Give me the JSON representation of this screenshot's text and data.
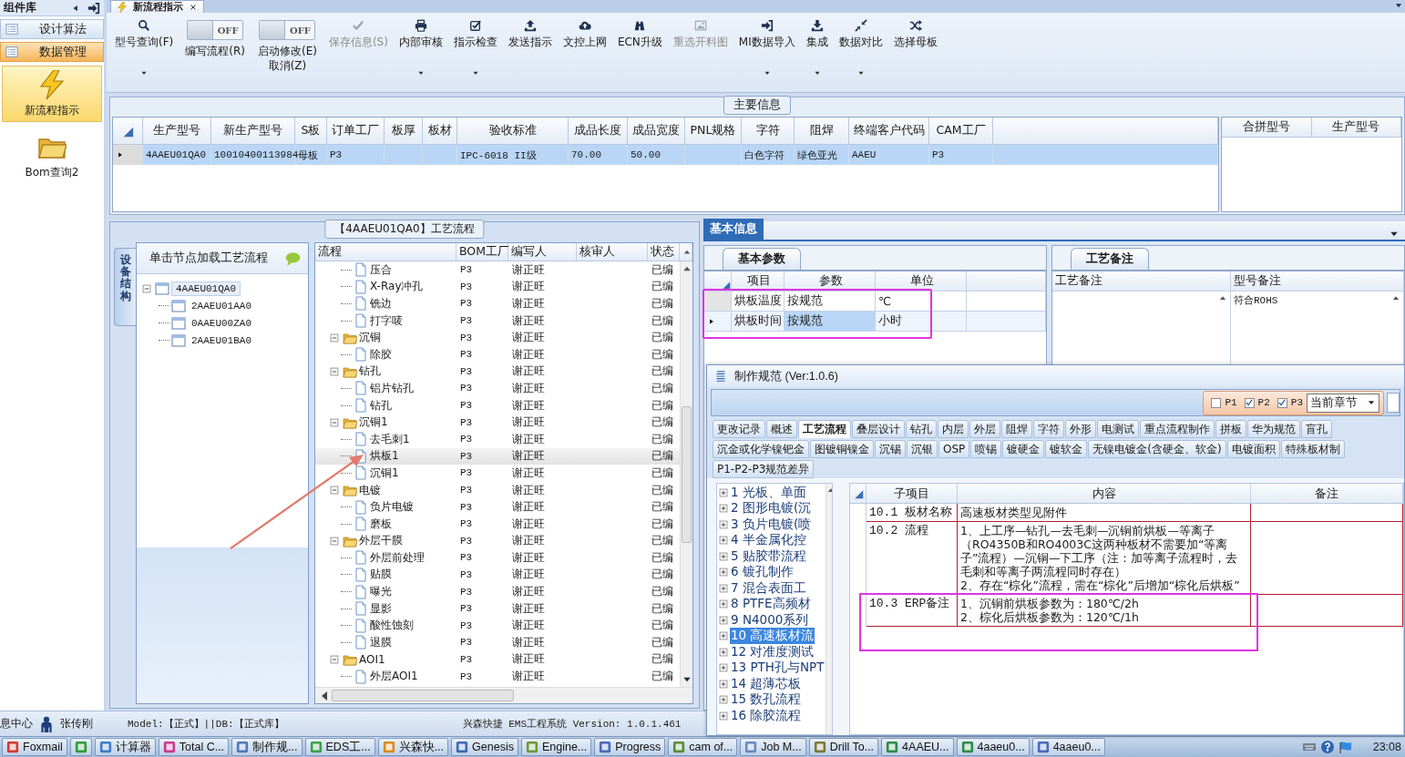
{
  "sidebar": {
    "title": "组件库",
    "groups": [
      {
        "label": "设计算法",
        "selected": false
      },
      {
        "label": "数据管理",
        "selected": true
      }
    ],
    "items": [
      {
        "label": "新流程指示",
        "selected": true
      },
      {
        "label": "Bom查询2",
        "selected": false
      }
    ]
  },
  "doc_tabs": [
    {
      "label": "新流程指示",
      "selected": true
    }
  ],
  "ribbon": [
    {
      "kind": "button",
      "label": "型号查询(F)",
      "dropdown": true,
      "disabled": false
    },
    {
      "kind": "toggle",
      "toggle_text": "OFF",
      "on": false,
      "label": "编写流程(R)"
    },
    {
      "kind": "toggle",
      "toggle_text": "OFF",
      "on": false,
      "label": "启动修改(E)\n取消(Z)"
    },
    {
      "kind": "button",
      "label": "保存信息(S)",
      "dropdown": false,
      "disabled": true
    },
    {
      "kind": "button",
      "label": "内部审核",
      "dropdown": true,
      "disabled": false
    },
    {
      "kind": "button",
      "label": "指示检查",
      "dropdown": true,
      "disabled": false
    },
    {
      "kind": "button",
      "label": "发送指示",
      "dropdown": false,
      "disabled": false
    },
    {
      "kind": "button",
      "label": "文控上网",
      "dropdown": false,
      "disabled": false
    },
    {
      "kind": "button",
      "label": "ECN升级",
      "dropdown": false,
      "disabled": false
    },
    {
      "kind": "button",
      "label": "重选开料图",
      "dropdown": false,
      "disabled": true
    },
    {
      "kind": "button",
      "label": "MI数据导入",
      "dropdown": true,
      "disabled": false
    },
    {
      "kind": "button",
      "label": "集成",
      "dropdown": true,
      "disabled": false
    },
    {
      "kind": "button",
      "label": "数据对比",
      "dropdown": true,
      "disabled": false
    },
    {
      "kind": "button",
      "label": "选择母板",
      "dropdown": false,
      "disabled": false
    }
  ],
  "main_info": {
    "title": "主要信息",
    "columns": [
      "生产型号",
      "新生产型号",
      "S板",
      "订单工厂",
      "板厚",
      "板材",
      "验收标准",
      "成品长度",
      "成品宽度",
      "PNL规格",
      "字符",
      "阻焊",
      "终端客户代码",
      "CAM工厂"
    ],
    "rows": [
      {
        "selected": true,
        "cells": [
          "4AAEU01QA0",
          "10010400113984",
          "母板",
          "P3",
          null,
          null,
          "IPC-6018 II级",
          "70.00",
          "50.00",
          null,
          "白色字符",
          "绿色亚光",
          "AAEU",
          "P3"
        ]
      }
    ],
    "merge_columns": [
      "合拼型号",
      "生产型号"
    ]
  },
  "process": {
    "title": "【4AAEU01QA0】工艺流程",
    "side_tab": "设备结构",
    "tree_header": "单击节点加载工艺流程",
    "tree": [
      {
        "label": "4AAEU01QA0",
        "expanded": true,
        "selected": true,
        "children": [
          {
            "label": "2AAEU01AA0",
            "selected": false
          },
          {
            "label": "0AAEU00ZA0",
            "selected": false
          },
          {
            "label": "2AAEU01BA0",
            "selected": false
          }
        ]
      }
    ],
    "columns": [
      "流程",
      "BOM工厂",
      "编写人",
      "核审人",
      "状态"
    ],
    "arrow_marker": true,
    "rows": [
      {
        "kind": "group",
        "children": [
          {
            "kind": "step",
            "label": "压合",
            "bom": "P3",
            "author": "谢正旺",
            "status": "已编",
            "selected": false
          },
          {
            "kind": "step",
            "label": "X-Ray冲孔",
            "bom": "P3",
            "author": "谢正旺",
            "status": "已编",
            "selected": false
          },
          {
            "kind": "step",
            "label": "铣边",
            "bom": "P3",
            "author": "谢正旺",
            "status": "已编",
            "selected": false
          },
          {
            "kind": "step",
            "label": "打字唛",
            "bom": "P3",
            "author": "谢正旺",
            "status": "已编",
            "selected": false
          }
        ]
      },
      {
        "kind": "folder",
        "label": "沉铜",
        "bom": "P3",
        "author": "谢正旺",
        "status": "已编",
        "selected": false,
        "expanded": true,
        "children": [
          {
            "kind": "step",
            "label": "除胶",
            "bom": "P3",
            "author": "谢正旺",
            "status": "已编",
            "selected": false
          }
        ]
      },
      {
        "kind": "folder",
        "label": "钻孔",
        "bom": "P3",
        "author": "谢正旺",
        "status": "已编",
        "selected": false,
        "expanded": true,
        "children": [
          {
            "kind": "step",
            "label": "铝片钻孔",
            "bom": "P3",
            "author": "谢正旺",
            "status": "已编",
            "selected": false
          },
          {
            "kind": "step",
            "label": "钻孔",
            "bom": "P3",
            "author": "谢正旺",
            "status": "已编",
            "selected": false
          }
        ]
      },
      {
        "kind": "folder",
        "label": "沉铜1",
        "bom": "P3",
        "author": "谢正旺",
        "status": "已编",
        "selected": false,
        "expanded": true,
        "children": [
          {
            "kind": "step",
            "label": "去毛刺1",
            "bom": "P3",
            "author": "谢正旺",
            "status": "已编",
            "selected": false
          },
          {
            "kind": "step",
            "label": "烘板1",
            "bom": "P3",
            "author": "谢正旺",
            "status": "已编",
            "selected": true
          },
          {
            "kind": "step",
            "label": "沉铜1",
            "bom": "P3",
            "author": "谢正旺",
            "status": "已编",
            "selected": false
          }
        ]
      },
      {
        "kind": "folder",
        "label": "电镀",
        "bom": "P3",
        "author": "谢正旺",
        "status": "已编",
        "selected": false,
        "expanded": true,
        "children": [
          {
            "kind": "step",
            "label": "负片电镀",
            "bom": "P3",
            "author": "谢正旺",
            "status": "已编",
            "selected": false
          },
          {
            "kind": "step",
            "label": "磨板",
            "bom": "P3",
            "author": "谢正旺",
            "status": "已编",
            "selected": false
          }
        ]
      },
      {
        "kind": "folder",
        "label": "外层干膜",
        "bom": "P3",
        "author": "谢正旺",
        "status": "已编",
        "selected": false,
        "expanded": true,
        "children": [
          {
            "kind": "step",
            "label": "外层前处理",
            "bom": "P3",
            "author": "谢正旺",
            "status": "已编",
            "selected": false
          },
          {
            "kind": "step",
            "label": "贴膜",
            "bom": "P3",
            "author": "谢正旺",
            "status": "已编",
            "selected": false
          },
          {
            "kind": "step",
            "label": "曝光",
            "bom": "P3",
            "author": "谢正旺",
            "status": "已编",
            "selected": false
          },
          {
            "kind": "step",
            "label": "显影",
            "bom": "P3",
            "author": "谢正旺",
            "status": "已编",
            "selected": false
          },
          {
            "kind": "step",
            "label": "酸性蚀刻",
            "bom": "P3",
            "author": "谢正旺",
            "status": "已编",
            "selected": false
          },
          {
            "kind": "step",
            "label": "退膜",
            "bom": "P3",
            "author": "谢正旺",
            "status": "已编",
            "selected": false
          }
        ]
      },
      {
        "kind": "folder",
        "label": "AOI1",
        "bom": "P3",
        "author": "谢正旺",
        "status": "已编",
        "selected": false,
        "expanded": true,
        "children": [
          {
            "kind": "step",
            "label": "外层AOI1",
            "bom": "P3",
            "author": "谢正旺",
            "status": "已编",
            "selected": false
          }
        ]
      }
    ]
  },
  "info": {
    "tabs": [
      {
        "label": "基本信息",
        "selected": true
      }
    ],
    "params": {
      "tab": "基本参数",
      "columns": [
        "项目",
        "参数",
        "单位"
      ],
      "highlight_box": true,
      "rows": [
        {
          "selected": false,
          "cells": [
            "烘板温度",
            "按规范",
            "℃"
          ]
        },
        {
          "selected": true,
          "cells": [
            "烘板时间",
            "按规范",
            "小时"
          ]
        }
      ]
    },
    "notes": {
      "tab": "工艺备注",
      "columns": [
        "工艺备注",
        "型号备注"
      ],
      "rows": [
        {
          "cells": [
            null,
            "符合ROHS"
          ]
        }
      ]
    }
  },
  "spec_window": {
    "title": "制作规范 (Ver:1.0.6)",
    "filters": [
      {
        "label": "P1",
        "checked": false
      },
      {
        "label": "P2",
        "checked": true
      },
      {
        "label": "P3",
        "checked": true
      }
    ],
    "scope": "当前章节",
    "tab_rows": [
      {
        "tabs": [
          {
            "label": "更改记录",
            "selected": false
          },
          {
            "label": "概述",
            "selected": false
          },
          {
            "label": "工艺流程",
            "selected": true
          },
          {
            "label": "叠层设计",
            "selected": false
          },
          {
            "label": "钻孔",
            "selected": false
          },
          {
            "label": "内层",
            "selected": false
          },
          {
            "label": "外层",
            "selected": false
          },
          {
            "label": "阻焊",
            "selected": false
          },
          {
            "label": "字符",
            "selected": false
          },
          {
            "label": "外形",
            "selected": false
          },
          {
            "label": "电测试",
            "selected": false
          },
          {
            "label": "重点流程制作",
            "selected": false
          },
          {
            "label": "拼板",
            "selected": false
          },
          {
            "label": "华为规范",
            "selected": false
          },
          {
            "label": "盲孔",
            "selected": false
          }
        ]
      },
      {
        "tabs": [
          {
            "label": "沉金或化学镍钯金",
            "selected": false
          },
          {
            "label": "图镀铜镍金",
            "selected": false
          },
          {
            "label": "沉锡",
            "selected": false
          },
          {
            "label": "沉银",
            "selected": false
          },
          {
            "label": "OSP",
            "selected": false
          },
          {
            "label": "喷锡",
            "selected": false
          },
          {
            "label": "镀硬金",
            "selected": false
          },
          {
            "label": "镀软金",
            "selected": false
          },
          {
            "label": "无镍电镀金(含硬金、软金)",
            "selected": false
          },
          {
            "label": "电镀面积",
            "selected": false
          },
          {
            "label": "特殊板材制",
            "selected": false
          }
        ]
      },
      {
        "tabs": [
          {
            "label": "P1-P2-P3规范差异",
            "selected": false
          }
        ]
      }
    ],
    "chapters": [
      {
        "label": "1 光板、单面",
        "selected": false,
        "expanded": false
      },
      {
        "label": "2 图形电镀(沉",
        "selected": false,
        "expanded": false
      },
      {
        "label": "3 负片电镀(喷",
        "selected": false,
        "expanded": false
      },
      {
        "label": "4 半金属化控",
        "selected": false,
        "expanded": false
      },
      {
        "label": "5 贴胶带流程",
        "selected": false,
        "expanded": false
      },
      {
        "label": "6 镀孔制作",
        "selected": false,
        "expanded": false
      },
      {
        "label": "7 混合表面工",
        "selected": false,
        "expanded": false
      },
      {
        "label": "8 PTFE高频材",
        "selected": false,
        "expanded": false
      },
      {
        "label": "9 N4000系列",
        "selected": false,
        "expanded": false
      },
      {
        "label": "10 高速板材流",
        "selected": true,
        "expanded": false
      },
      {
        "label": "12 对准度测试",
        "selected": false,
        "expanded": false
      },
      {
        "label": "13 PTH孔与NPT",
        "selected": false,
        "expanded": false
      },
      {
        "label": "14 超薄芯板",
        "selected": false,
        "expanded": false
      },
      {
        "label": "15 数孔流程",
        "selected": false,
        "expanded": false
      },
      {
        "label": "16 除胶流程",
        "selected": false,
        "expanded": false
      }
    ],
    "columns": [
      "子项目",
      "内容",
      "备注"
    ],
    "rows": [
      {
        "item": "10.1 板材名称",
        "content": "高速板材类型见附件",
        "highlighted": false
      },
      {
        "item": "10.2 流程",
        "content": "1、上工序—钻孔—去毛刺—沉铜前烘板—等离子（RO4350B和RO4003C这两种板材不需要加“等离子”流程）—沉铜—下工序（注：加等离子流程时，去毛刺和等离子两流程同时存在）\n2、存在“棕化”流程，需在“棕化”后增加“棕化后烘板”",
        "highlighted": false
      },
      {
        "item": "10.3 ERP备注",
        "content": "1、沉铜前烘板参数为：180℃/2h\n2、棕化后烘板参数为：120℃/1h",
        "highlighted": true
      }
    ]
  },
  "status_bar": {
    "left": "息中心",
    "user": "张传刚",
    "model": "Model:【正式】||DB:【正式库】",
    "version": "兴森快捷 EMS工程系统 Version: 1.0.1.461"
  },
  "taskbar": {
    "items": [
      {
        "label": "Foxmail",
        "selected": false
      },
      {
        "selected": false
      },
      {
        "label": "计算器",
        "selected": false
      },
      {
        "label": "Total C...",
        "selected": false
      },
      {
        "label": "制作规...",
        "selected": false
      },
      {
        "label": "EDS工...",
        "selected": false
      },
      {
        "label": "兴森快...",
        "selected": false
      },
      {
        "label": "Genesis",
        "selected": false
      },
      {
        "label": "Engine...",
        "selected": false
      },
      {
        "label": "Progress",
        "selected": false
      },
      {
        "label": "cam of...",
        "selected": false
      },
      {
        "label": "Job M...",
        "selected": false
      },
      {
        "label": "Drill To...",
        "selected": false
      },
      {
        "label": "4AAEU...",
        "selected": false
      },
      {
        "label": "4aaeu0...",
        "selected": false
      },
      {
        "label": "4aaeu0...",
        "selected": false
      }
    ],
    "clock": "23:08"
  }
}
